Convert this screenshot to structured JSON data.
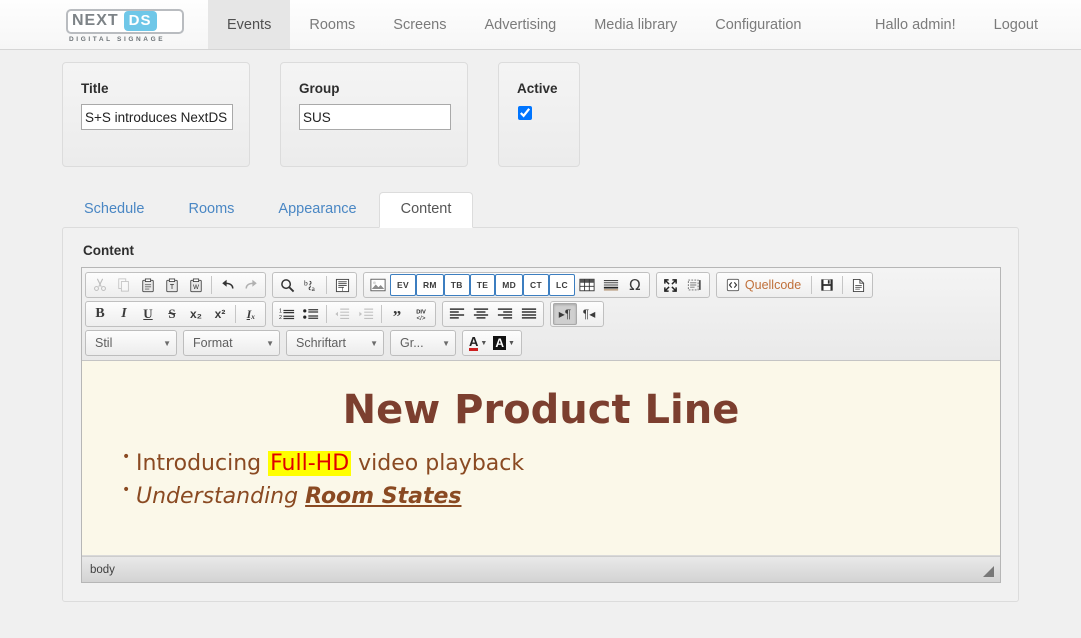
{
  "navbar": {
    "logo": {
      "name": "NEXT",
      "badge": "DS",
      "sub": "DIGITAL SIGNAGE"
    },
    "items": [
      {
        "label": "Events",
        "active": true
      },
      {
        "label": "Rooms",
        "active": false
      },
      {
        "label": "Screens",
        "active": false
      },
      {
        "label": "Advertising",
        "active": false
      },
      {
        "label": "Media library",
        "active": false
      },
      {
        "label": "Configuration",
        "active": false
      }
    ],
    "greeting": "Hallo admin!",
    "logout": "Logout"
  },
  "panels": {
    "title": {
      "label": "Title",
      "value": "S+S introduces NextDS"
    },
    "group": {
      "label": "Group",
      "value": "SUS"
    },
    "active": {
      "label": "Active",
      "checked": true
    }
  },
  "tabs": [
    {
      "label": "Schedule",
      "active": false
    },
    {
      "label": "Rooms",
      "active": false
    },
    {
      "label": "Appearance",
      "active": false
    },
    {
      "label": "Content",
      "active": true
    }
  ],
  "content": {
    "heading": "Content",
    "editor": {
      "toolbar": {
        "row1": {
          "clipboard": [
            {
              "name": "cut-icon",
              "title": "Ausschneiden",
              "disabled": true
            },
            {
              "name": "copy-icon",
              "title": "Kopieren",
              "disabled": true
            },
            {
              "name": "paste-icon",
              "title": "Einfügen",
              "disabled": false
            },
            {
              "name": "paste-text-icon",
              "title": "Als Text einfügen",
              "disabled": false
            },
            {
              "name": "paste-word-icon",
              "title": "Aus Word einfügen",
              "disabled": false
            },
            {
              "name": "undo-icon",
              "title": "Rückgängig",
              "disabled": false
            },
            {
              "name": "redo-icon",
              "title": "Wiederherstellen",
              "disabled": true
            }
          ],
          "find": [
            {
              "name": "search-icon",
              "title": "Suchen"
            },
            {
              "name": "replace-icon",
              "title": "Ersetzen"
            },
            {
              "name": "select-all-icon",
              "title": "Alles auswählen"
            }
          ],
          "insert_labels": [
            "EV",
            "RM",
            "TB",
            "TE",
            "MD",
            "CT",
            "LC"
          ],
          "insert_other": [
            {
              "name": "image-icon",
              "title": "Bild"
            },
            {
              "name": "table-icon",
              "title": "Tabelle"
            },
            {
              "name": "horizontal-rule-icon",
              "title": "Horizontale Linie"
            },
            {
              "name": "special-char-icon",
              "title": "Sonderzeichen",
              "glyph": "Ω"
            }
          ],
          "view": [
            {
              "name": "maximize-icon",
              "title": "Maximieren"
            },
            {
              "name": "show-blocks-icon",
              "title": "Blocks anzeigen"
            }
          ],
          "docgroup": {
            "source_label": "Quellcode",
            "buttons": [
              {
                "name": "save-icon",
                "title": "Speichern"
              },
              {
                "name": "new-page-icon",
                "title": "Neue Seite"
              }
            ]
          }
        },
        "row2": {
          "basic": [
            {
              "name": "bold-icon",
              "glyph": "B",
              "title": "Fett"
            },
            {
              "name": "italic-icon",
              "glyph": "I",
              "title": "Kursiv"
            },
            {
              "name": "underline-icon",
              "glyph": "U",
              "title": "Unterstrichen"
            },
            {
              "name": "strikethrough-icon",
              "glyph": "S",
              "title": "Durchgestrichen"
            },
            {
              "name": "subscript-icon",
              "glyph": "x₂",
              "title": "Tiefgestellt"
            },
            {
              "name": "superscript-icon",
              "glyph": "x²",
              "title": "Hochgestellt"
            },
            {
              "name": "remove-format-icon",
              "glyph": "Iₓ",
              "title": "Formatierung entfernen"
            }
          ],
          "paragraph": [
            {
              "name": "numbered-list-icon",
              "title": "Nummerierte Liste",
              "disabled": false
            },
            {
              "name": "bulleted-list-icon",
              "title": "Liste",
              "disabled": false
            },
            {
              "name": "outdent-icon",
              "title": "Einzug verkleinern",
              "disabled": true
            },
            {
              "name": "indent-icon",
              "title": "Einzug vergrößern",
              "disabled": true
            },
            {
              "name": "blockquote-icon",
              "title": "Zitatblock",
              "glyph": "”",
              "disabled": false
            },
            {
              "name": "create-div-icon",
              "title": "DIV Container",
              "disabled": false
            }
          ],
          "align": [
            {
              "name": "align-left-icon",
              "title": "Linksbündig"
            },
            {
              "name": "align-center-icon",
              "title": "Zentriert"
            },
            {
              "name": "align-right-icon",
              "title": "Rechtsbündig"
            },
            {
              "name": "align-justify-icon",
              "title": "Blocksatz"
            }
          ],
          "direction": [
            {
              "name": "text-direction-ltr-icon",
              "glyph": "▸¶",
              "pressed": true
            },
            {
              "name": "text-direction-rtl-icon",
              "glyph": "¶◂",
              "pressed": false
            }
          ]
        },
        "row3": {
          "combos": [
            {
              "name": "styles-combo",
              "label": "Stil"
            },
            {
              "name": "format-combo",
              "label": "Format"
            },
            {
              "name": "font-combo",
              "label": "Schriftart"
            },
            {
              "name": "fontsize-combo",
              "label": "Gr..."
            }
          ],
          "colors": [
            {
              "name": "text-color-button",
              "glyph": "A"
            },
            {
              "name": "background-color-button",
              "glyph": "A"
            }
          ]
        }
      },
      "document": {
        "title": "New Product Line",
        "bullets": [
          {
            "parts": [
              {
                "text": "Introducing ",
                "style": "plain"
              },
              {
                "text": "Full-HD",
                "style": "highlight"
              },
              {
                "text": " video playback",
                "style": "plain"
              }
            ]
          },
          {
            "parts": [
              {
                "text": "Understanding ",
                "style": "italic"
              },
              {
                "text": "Room States",
                "style": "bold-italic-underline"
              }
            ]
          }
        ]
      },
      "statusbar": {
        "path": "body"
      }
    }
  }
}
